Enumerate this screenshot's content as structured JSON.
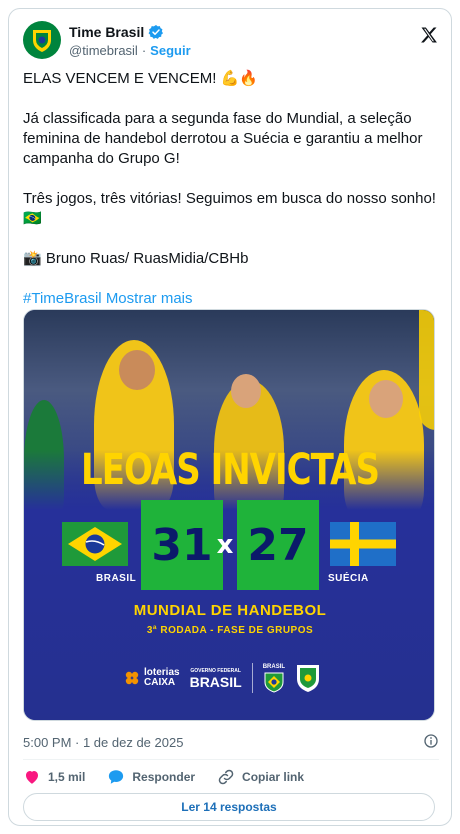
{
  "author": {
    "name": "Time Brasil",
    "handle": "@timebrasil",
    "follow_label": "Seguir",
    "verified": true,
    "avatar_color": "#00843d"
  },
  "tweet": {
    "line1": "ELAS VENCEM E VENCEM! 💪🔥",
    "line2": "Já classificada para a segunda fase do Mundial, a seleção feminina de handebol derrotou a Suécia e garantiu a melhor campanha do Grupo G!",
    "line3": "Três jogos, três vitórias! Seguimos em busca do nosso sonho! 🇧🇷",
    "line4": "📸 Bruno Ruas/ RuasMidia/CBHb",
    "hashtag": "#TimeBrasil",
    "show_more": "Mostrar mais"
  },
  "media": {
    "headline": "LEOAS INVICTAS",
    "score_home": "31",
    "score_sep": "x",
    "score_away": "27",
    "team_home": "BRASIL",
    "team_away": "SUÉCIA",
    "event": "MUNDIAL DE HANDEBOL",
    "round": "3ª RODADA - FASE DE GRUPOS",
    "sponsor1_a": "loterias",
    "sponsor1_b": "CAIXA",
    "sponsor2_a": "GOVERNO FEDERAL",
    "sponsor2_b": "BRASIL",
    "sponsor3": "BRASIL",
    "colors": {
      "bg": "#25308f",
      "yellow": "#ffd400",
      "green": "#1fb33a",
      "navy": "#0b1a6a"
    }
  },
  "meta": {
    "time": "5:00 PM · 1 de dez de 2025"
  },
  "actions": {
    "likes": "1,5 mil",
    "reply": "Responder",
    "copy_link": "Copiar link",
    "read_replies": "Ler 14 respostas"
  }
}
